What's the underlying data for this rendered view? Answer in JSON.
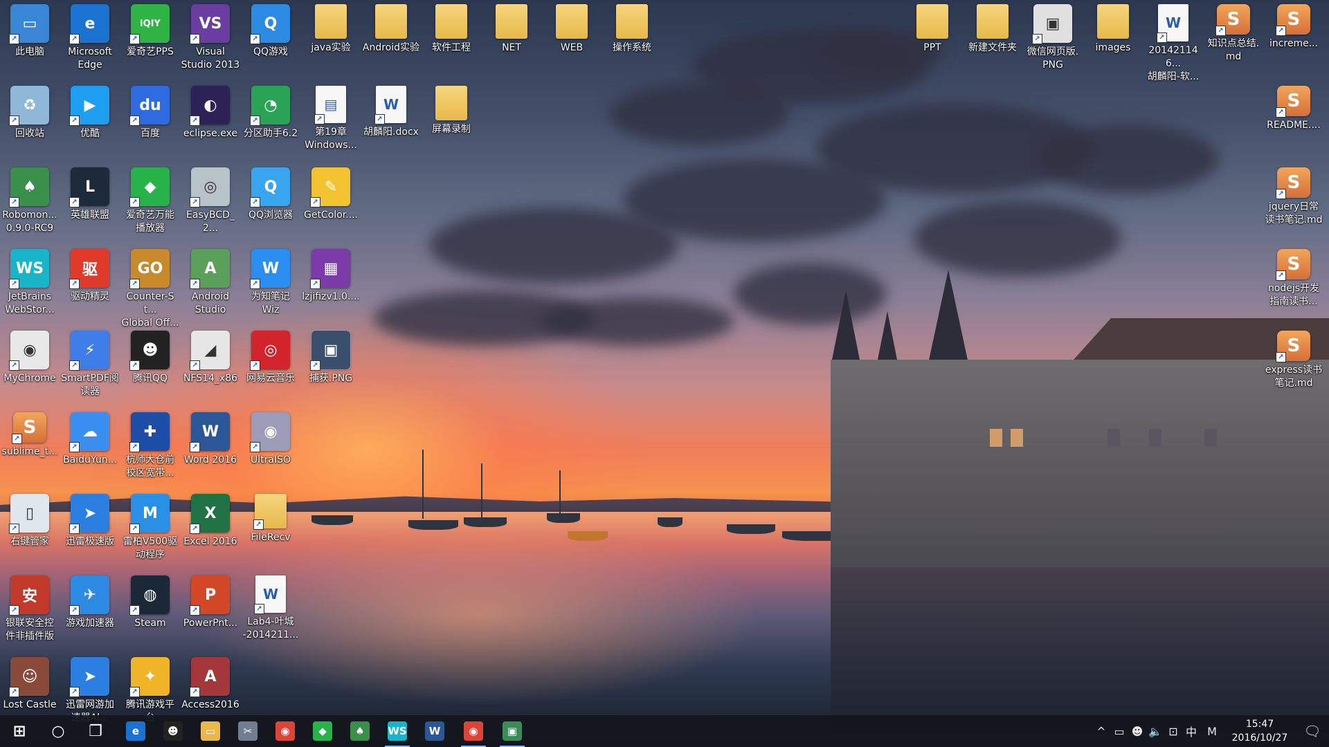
{
  "desktop_icons": [
    {
      "label": "此电脑",
      "icon": "computer-icon",
      "color": "#3a86d6",
      "glyph": "▭",
      "kind": "app"
    },
    {
      "label": "Microsoft\nEdge",
      "icon": "edge-icon",
      "color": "#1a73d1",
      "glyph": "e",
      "kind": "app"
    },
    {
      "label": "爱奇艺PPS",
      "icon": "iqiyi-icon",
      "color": "#2fb344",
      "glyph": "iQIY",
      "kind": "app"
    },
    {
      "label": "Visual\nStudio 2013",
      "icon": "visual-studio-icon",
      "color": "#6a3ea1",
      "glyph": "VS",
      "kind": "app"
    },
    {
      "label": "QQ游戏",
      "icon": "qq-game-icon",
      "color": "#2d8ae2",
      "glyph": "Q",
      "kind": "app"
    },
    {
      "label": "java实验",
      "icon": "folder-icon",
      "kind": "folder"
    },
    {
      "label": "Android实验",
      "icon": "folder-icon",
      "kind": "folder"
    },
    {
      "label": "软件工程",
      "icon": "folder-icon",
      "kind": "folder"
    },
    {
      "label": "NET",
      "icon": "folder-icon",
      "kind": "folder"
    },
    {
      "label": "WEB",
      "icon": "folder-icon",
      "kind": "folder"
    },
    {
      "label": "操作系统",
      "icon": "folder-icon",
      "kind": "folder"
    },
    {
      "label": "回收站",
      "icon": "recycle-bin-icon",
      "color": "#8fb7d8",
      "glyph": "♻",
      "kind": "app"
    },
    {
      "label": "优酷",
      "icon": "youku-icon",
      "color": "#1e9ef0",
      "glyph": "▶",
      "kind": "app"
    },
    {
      "label": "百度",
      "icon": "baidu-icon",
      "color": "#2f6be0",
      "glyph": "du",
      "kind": "app"
    },
    {
      "label": "eclipse.exe",
      "icon": "eclipse-icon",
      "color": "#2c2255",
      "glyph": "◐",
      "kind": "app"
    },
    {
      "label": "分区助手6.2",
      "icon": "partition-assistant-icon",
      "color": "#2aa356",
      "glyph": "◔",
      "kind": "app"
    },
    {
      "label": "第19章\nWindows...",
      "icon": "image-file-icon",
      "color": "#ffffff",
      "glyph": "▤",
      "kind": "doc"
    },
    {
      "label": "胡麟阳.docx",
      "icon": "word-document-icon",
      "kind": "doc",
      "glyph": "W"
    },
    {
      "label": "屏幕录制",
      "icon": "folder-icon",
      "kind": "folder"
    },
    {
      "label": "Robomon...\n0.9.0-RC9",
      "icon": "robomongo-icon",
      "color": "#3a8f4a",
      "glyph": "♠",
      "kind": "app"
    },
    {
      "label": "英雄联盟",
      "icon": "league-of-legends-icon",
      "color": "#1c2a3c",
      "glyph": "L",
      "kind": "app"
    },
    {
      "label": "爱奇艺万能\n播放器",
      "icon": "iqiyi-player-icon",
      "color": "#27b24a",
      "glyph": "◆",
      "kind": "app"
    },
    {
      "label": "EasyBCD_2...",
      "icon": "easybcd-icon",
      "color": "#b8c3c9",
      "glyph": "◎",
      "kind": "app"
    },
    {
      "label": "QQ浏览器",
      "icon": "qq-browser-icon",
      "color": "#3aa5ef",
      "glyph": "Q",
      "kind": "app"
    },
    {
      "label": "GetColor....",
      "icon": "getcolor-icon",
      "color": "#f2c230",
      "glyph": "✎",
      "kind": "app"
    },
    {
      "label": "JetBrains\nWebStor...",
      "icon": "webstorm-icon",
      "color": "#18b4c9",
      "glyph": "WS",
      "kind": "app"
    },
    {
      "label": "驱动精灵",
      "icon": "driver-genius-icon",
      "color": "#e03a2a",
      "glyph": "驱",
      "kind": "app"
    },
    {
      "label": "Counter-St...\nGlobal Off...",
      "icon": "csgo-icon",
      "color": "#c98a2b",
      "glyph": "GO",
      "kind": "app"
    },
    {
      "label": "Android\nStudio",
      "icon": "android-studio-icon",
      "color": "#5ba05a",
      "glyph": "A",
      "kind": "app"
    },
    {
      "label": "为知笔记\nWiz",
      "icon": "wiz-note-icon",
      "color": "#2a8ef0",
      "glyph": "W",
      "kind": "app"
    },
    {
      "label": "lzjifizv1.0....",
      "icon": "winrar-archive-icon",
      "color": "#7a3aa8",
      "glyph": "▦",
      "kind": "app"
    },
    {
      "label": "MyChrome",
      "icon": "chrome-icon",
      "color": "#e8e8e8",
      "glyph": "◉",
      "kind": "app"
    },
    {
      "label": "SmartPDF阅\n读器",
      "icon": "smartpdf-icon",
      "color": "#3f7ee8",
      "glyph": "⚡",
      "kind": "app"
    },
    {
      "label": "腾讯QQ",
      "icon": "qq-penguin-icon",
      "color": "#222222",
      "glyph": "☻",
      "kind": "app"
    },
    {
      "label": "NFS14_x86",
      "icon": "nfs-icon",
      "color": "#e6e6e6",
      "glyph": "◢",
      "kind": "app"
    },
    {
      "label": "网易云音乐",
      "icon": "netease-music-icon",
      "color": "#d3232c",
      "glyph": "◎",
      "kind": "app"
    },
    {
      "label": "捕获.PNG",
      "icon": "png-image-icon",
      "color": "#3a4f6b",
      "glyph": "▣",
      "kind": "app",
      "selected": true
    },
    {
      "label": "sublime_t...",
      "icon": "sublime-text-icon",
      "kind": "s",
      "glyph": "S"
    },
    {
      "label": "BaiduYun...",
      "icon": "baidu-yun-icon",
      "color": "#3a8ef0",
      "glyph": "☁",
      "kind": "app"
    },
    {
      "label": "杭师大仓前\n校区宽带...",
      "icon": "network-icon",
      "color": "#1c4ea8",
      "glyph": "✚",
      "kind": "app"
    },
    {
      "label": "Word 2016",
      "icon": "word-icon",
      "color": "#2b5797",
      "glyph": "W",
      "kind": "app"
    },
    {
      "label": "UltraISO",
      "icon": "ultraiso-icon",
      "color": "#9c9cb8",
      "glyph": "◉",
      "kind": "app"
    },
    {
      "label": "右键管家",
      "icon": "mouse-manager-icon",
      "color": "#dfe6ee",
      "glyph": "▯",
      "kind": "app"
    },
    {
      "label": "迅雷极速版",
      "icon": "thunder-icon",
      "color": "#2a7fe0",
      "glyph": "➤",
      "kind": "app"
    },
    {
      "label": "雷柏V500驱\n动程序",
      "icon": "rapoo-icon",
      "color": "#2a90e6",
      "glyph": "M",
      "kind": "app"
    },
    {
      "label": "Excel 2016",
      "icon": "excel-icon",
      "color": "#207245",
      "glyph": "X",
      "kind": "app"
    },
    {
      "label": "FileRecv",
      "icon": "folder-icon",
      "kind": "folder"
    },
    {
      "label": "银联安全控\n件非插件版",
      "icon": "unionpay-security-icon",
      "color": "#c0392b",
      "glyph": "安",
      "kind": "app"
    },
    {
      "label": "游戏加速器",
      "icon": "game-accelerator-icon",
      "color": "#2d8ae2",
      "glyph": "✈",
      "kind": "app"
    },
    {
      "label": "Steam",
      "icon": "steam-icon",
      "color": "#1b2838",
      "glyph": "◍",
      "kind": "app"
    },
    {
      "label": "PowerPnt...",
      "icon": "powerpoint-icon",
      "color": "#d24726",
      "glyph": "P",
      "kind": "app"
    },
    {
      "label": "Lab4-叶城\n-2014211...",
      "icon": "word-document-icon",
      "kind": "doc",
      "glyph": "W"
    },
    {
      "label": "Lost Castle",
      "icon": "lost-castle-icon",
      "color": "#8a4a3a",
      "glyph": "☺",
      "kind": "app"
    },
    {
      "label": "迅雷网游加\n速器Al...",
      "icon": "thunder-game-icon",
      "color": "#2a7fe0",
      "glyph": "➤",
      "kind": "app"
    },
    {
      "label": "腾讯游戏平\n台",
      "icon": "tencent-games-icon",
      "color": "#f0b429",
      "glyph": "✦",
      "kind": "app"
    },
    {
      "label": "Access2016",
      "icon": "access-icon",
      "color": "#a4373a",
      "glyph": "A",
      "kind": "app"
    },
    {
      "label": "PPT",
      "icon": "folder-icon",
      "kind": "folder"
    },
    {
      "label": "新建文件夹",
      "icon": "folder-icon",
      "kind": "folder"
    },
    {
      "label": "微信网页版.\nPNG",
      "icon": "png-image-icon",
      "color": "#e0e0e0",
      "glyph": "▣",
      "kind": "app"
    },
    {
      "label": "images",
      "icon": "folder-icon",
      "kind": "folder"
    },
    {
      "label": "201421146...\n胡麟阳-软...",
      "icon": "word-document-icon",
      "kind": "doc",
      "glyph": "W"
    },
    {
      "label": "知识点总结.\nmd",
      "icon": "sublime-text-icon",
      "kind": "s",
      "glyph": "S"
    },
    {
      "label": "increme...",
      "icon": "sublime-text-icon",
      "kind": "s",
      "glyph": "S"
    },
    {
      "label": "README....",
      "icon": "sublime-text-icon",
      "kind": "s",
      "glyph": "S"
    },
    {
      "label": "jquery日常\n读书笔记.md",
      "icon": "sublime-text-icon",
      "kind": "s",
      "glyph": "S"
    },
    {
      "label": "nodejs开发\n指南读书...",
      "icon": "sublime-text-icon",
      "kind": "s",
      "glyph": "S"
    },
    {
      "label": "express读书\n笔记.md",
      "icon": "sublime-text-icon",
      "kind": "s",
      "glyph": "S"
    }
  ],
  "taskbar": {
    "apps": [
      {
        "icon": "windows-start-icon",
        "glyph": "⊞",
        "color": "transparent",
        "active": false
      },
      {
        "icon": "cortana-search-icon",
        "glyph": "○",
        "color": "transparent",
        "active": false
      },
      {
        "icon": "task-view-icon",
        "glyph": "❐",
        "color": "transparent",
        "active": false
      },
      {
        "icon": "edge-icon",
        "glyph": "e",
        "color": "#1a73d1",
        "active": false
      },
      {
        "icon": "qq-penguin-icon",
        "glyph": "☻",
        "color": "#222222",
        "active": false
      },
      {
        "icon": "file-explorer-icon",
        "glyph": "▭",
        "color": "#e8b84a",
        "active": false
      },
      {
        "icon": "snipping-tool-icon",
        "glyph": "✂",
        "color": "#6f7f8f",
        "active": false
      },
      {
        "icon": "chrome-icon",
        "glyph": "◉",
        "color": "#db4437",
        "active": false
      },
      {
        "icon": "iqiyi-player-icon",
        "glyph": "◆",
        "color": "#27b24a",
        "active": false
      },
      {
        "icon": "robomongo-icon",
        "glyph": "♠",
        "color": "#3a8f4a",
        "active": false
      },
      {
        "icon": "webstorm-icon",
        "glyph": "WS",
        "color": "#18b4c9",
        "active": true
      },
      {
        "icon": "word-icon",
        "glyph": "W",
        "color": "#2b5797",
        "active": false
      },
      {
        "icon": "chrome-icon",
        "glyph": "◉",
        "color": "#db4437",
        "active": true
      },
      {
        "icon": "photos-icon",
        "glyph": "▣",
        "color": "#3a8a5a",
        "active": true
      }
    ],
    "tray": [
      {
        "icon": "show-hidden-icons-chevron-icon",
        "glyph": "^"
      },
      {
        "icon": "battery-icon",
        "glyph": "▭"
      },
      {
        "icon": "qq-tray-icon",
        "glyph": "☻"
      },
      {
        "icon": "volume-icon",
        "glyph": "🔈"
      },
      {
        "icon": "network-icon",
        "glyph": "⊡"
      },
      {
        "icon": "input-method-icon",
        "glyph": "中"
      },
      {
        "icon": "mail-tray-icon",
        "glyph": "M"
      }
    ],
    "clock": {
      "time": "15:47",
      "date": "2016/10/27"
    },
    "notification_icon": "action-center-icon"
  }
}
